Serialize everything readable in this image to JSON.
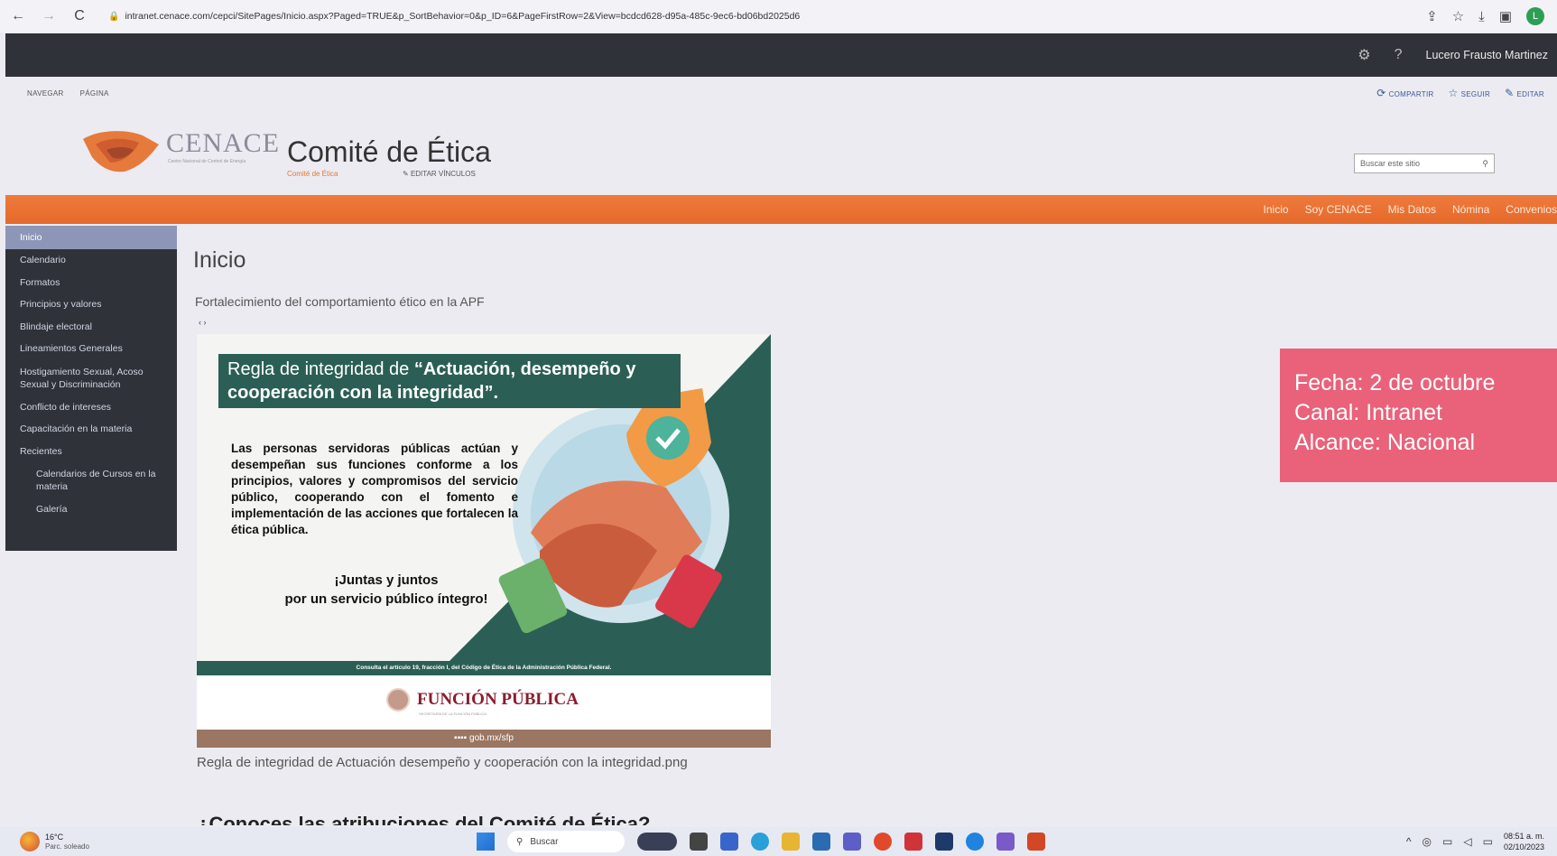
{
  "browser": {
    "url": "intranet.cenace.com/cepci/SitePages/Inicio.aspx?Paged=TRUE&p_SortBehavior=0&p_ID=6&PageFirstRow=2&View=bcdcd628-d95a-485c-9ec6-bd06bd2025d6",
    "back_icon": "←",
    "forward_icon": "→",
    "reload_icon": "C",
    "profile_initial": "L"
  },
  "suite_bar": {
    "user_name": "Lucero Frausto Martinez",
    "help": "?"
  },
  "ribbon": {
    "tabs": [
      "NAVEGAR",
      "PÁGINA"
    ],
    "share": "COMPARTIR",
    "follow": "SEGUIR",
    "edit": "EDITAR"
  },
  "header": {
    "logo_text": "CENACE",
    "logo_subtitle": "Centro Nacional de Control de Energía",
    "site_title": "Comité de Ética",
    "breadcrumb": "Comité de Ética",
    "edit_links": "EDITAR VÍNCULOS",
    "search_placeholder": "Buscar este sitio"
  },
  "top_nav": [
    "Inicio",
    "Soy CENACE",
    "Mis Datos",
    "Nómina",
    "Convenios"
  ],
  "sidebar": {
    "items": [
      {
        "label": "Inicio",
        "active": true
      },
      {
        "label": "Calendario"
      },
      {
        "label": "Formatos"
      },
      {
        "label": "Principios y valores"
      },
      {
        "label": "Blindaje electoral"
      },
      {
        "label": "Lineamientos Generales"
      },
      {
        "label": "Hostigamiento Sexual, Acoso Sexual y Discriminación"
      },
      {
        "label": "Conflicto de intereses"
      },
      {
        "label": "Capacitación en la materia"
      },
      {
        "label": "Recientes"
      },
      {
        "label": "Calendarios de Cursos en la materia",
        "sub": true
      },
      {
        "label": "Galería",
        "sub": true
      }
    ]
  },
  "main": {
    "heading": "Inicio",
    "subheading": "Fortalecimiento del comportamiento ético en la APF",
    "arrows": "‹ ›",
    "caption": "Regla de integridad de Actuación desempeño y cooperación con la integridad.png",
    "next_heading": "¿Conoces las atribuciones del Comité de Ética?"
  },
  "poster": {
    "title_prefix": "Regla de integridad de ",
    "title_bold": "“Actuación, desempeño y cooperación con la integridad”.",
    "body": "Las personas servidoras públicas actúan y desempeñan sus funciones conforme a los principios, valores y compromisos del servicio público, cooperando con el fomento e implementación de las acciones que fortalecen la ética pública.",
    "slogan_line1": "¡Juntas y juntos",
    "slogan_line2": "por un servicio público íntegro!",
    "footer_note": "Consulta el artículo 19, fracción I, del Código de Ética de la Administración Pública Federal.",
    "brand": "FUNCIÓN PÚBLICA",
    "brand_sub": "SECRETARÍA DE LA FUNCIÓN PÚBLICA",
    "social": "gob.mx/sfp"
  },
  "info_box": {
    "line1": "Fecha: 2 de octubre",
    "line2": "Canal: Intranet",
    "line3": "Alcance: Nacional"
  },
  "taskbar": {
    "temperature": "16°C",
    "condition": "Parc. soleado",
    "search_label": "Buscar",
    "time": "08:51 a. m.",
    "date": "02/10/2023"
  },
  "colors": {
    "orange_nav": "#e56a2a",
    "suite_bar": "#2f3238",
    "poster_teal": "#2b5f55",
    "info_box": "#e9627a"
  }
}
